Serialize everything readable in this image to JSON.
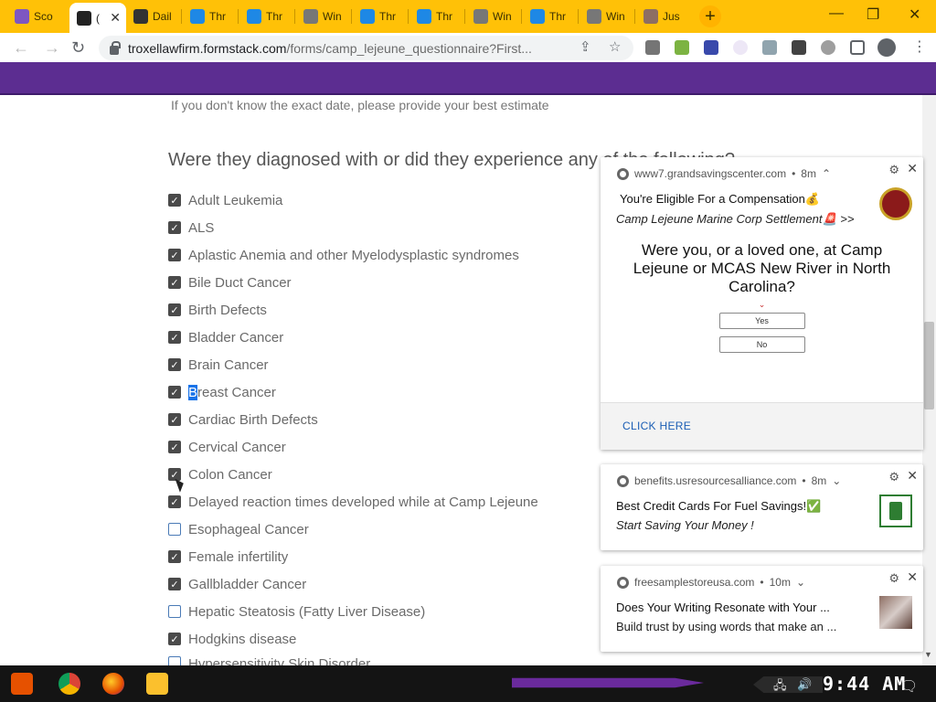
{
  "browser": {
    "tabs": [
      {
        "label": "Sco",
        "favicon": "#7e57c2"
      },
      {
        "label": "(",
        "favicon": "#222222",
        "active": true
      },
      {
        "label": "Dail",
        "favicon": "#333333"
      },
      {
        "label": "Thr",
        "favicon": "#1e88e5"
      },
      {
        "label": "Thr",
        "favicon": "#1e88e5"
      },
      {
        "label": "Win",
        "favicon": "#777777"
      },
      {
        "label": "Thr",
        "favicon": "#1e88e5"
      },
      {
        "label": "Thr",
        "favicon": "#1e88e5"
      },
      {
        "label": "Win",
        "favicon": "#777777"
      },
      {
        "label": "Thr",
        "favicon": "#1e88e5"
      },
      {
        "label": "Win",
        "favicon": "#777777"
      },
      {
        "label": "Jus",
        "favicon": "#8d6e63"
      }
    ],
    "url_domain": "troxellawfirm.formstack.com",
    "url_path": "/forms/camp_lejeune_questionnaire?First...",
    "accent_color": "#ffc107"
  },
  "form": {
    "hint": "If you don't know the exact date, please provide your best estimate",
    "question": "Were they diagnosed with or did they experience any of the following?",
    "options": [
      {
        "label": "Adult Leukemia",
        "checked": true
      },
      {
        "label": "ALS",
        "checked": true
      },
      {
        "label": "Aplastic Anemia and other Myelodysplastic syndromes",
        "checked": true
      },
      {
        "label": "Bile Duct Cancer",
        "checked": true
      },
      {
        "label": "Birth Defects",
        "checked": true
      },
      {
        "label": "Bladder Cancer",
        "checked": true
      },
      {
        "label": "Brain Cancer",
        "checked": true
      },
      {
        "label": "Breast Cancer",
        "checked": true,
        "sel_char": "B",
        "rest": "reast Cancer"
      },
      {
        "label": "Cardiac Birth Defects",
        "checked": true
      },
      {
        "label": "Cervical Cancer",
        "checked": true
      },
      {
        "label": "Colon Cancer",
        "checked": true
      },
      {
        "label": "Delayed reaction times developed while at Camp Lejeune",
        "checked": true
      },
      {
        "label": "Esophageal Cancer",
        "checked": false
      },
      {
        "label": "Female infertility",
        "checked": true
      },
      {
        "label": "Gallbladder Cancer",
        "checked": true
      },
      {
        "label": "Hepatic Steatosis (Fatty Liver Disease)",
        "checked": false
      },
      {
        "label": "Hodgkins disease",
        "checked": true
      },
      {
        "label": "Hypersensitivity Skin Disorder",
        "checked": false
      }
    ]
  },
  "notifications": [
    {
      "source": "www7.grandsavingscenter.com",
      "age": "8m",
      "title": "You're Eligible For a Compensation💰",
      "subtitle": "Camp Lejeune Marine Corp Settlement🚨 >>",
      "question": "Were you, or a loved one, at Camp Lejeune or MCAS New River in North Carolina?",
      "yes_label": "Yes",
      "no_label": "No",
      "link": "CLICK HERE"
    },
    {
      "source": "benefits.usresourcesalliance.com",
      "age": "8m",
      "title": "Best Credit Cards For Fuel Savings!✅",
      "subtitle": "Start Saving Your Money !"
    },
    {
      "source": "freesamplestoreusa.com",
      "age": "10m",
      "title": "Does Your Writing Resonate with Your ...",
      "subtitle": "Build trust by using words that make an ..."
    }
  ],
  "taskbar": {
    "clock": "9:44 AM"
  }
}
